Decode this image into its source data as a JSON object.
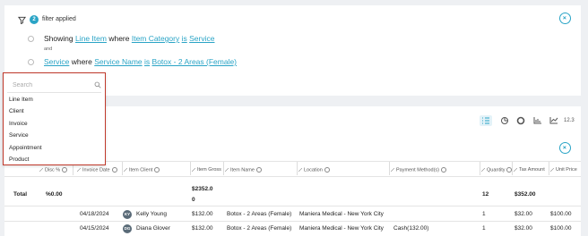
{
  "filter": {
    "count": "2",
    "label": "filter applied",
    "conditions": [
      {
        "prefix": "Showing",
        "field": "Line Item",
        "where": "where",
        "attribute": "Item Category",
        "operator": "is",
        "value": "Service"
      },
      {
        "prefix": "",
        "field": "Service",
        "where": "where",
        "attribute": "Service Name",
        "operator": "is",
        "value": "Botox - 2 Areas (Female)"
      }
    ],
    "and_label": "and"
  },
  "dropdown": {
    "search_placeholder": "Search",
    "items": [
      "Line Item",
      "Client",
      "Invoice",
      "Service",
      "Appointment",
      "Product"
    ]
  },
  "toolbar": {
    "number_format_label": "12.3"
  },
  "table": {
    "headers": [
      "Disc %",
      "Invoice Date",
      "Item Client",
      "Item Gross",
      "Item Name",
      "Location",
      "Payment Method(s)",
      "Quantity",
      "Tax Amount",
      "Unit Price"
    ],
    "total": {
      "label": "Total",
      "disc": "%0.00",
      "gross_line1": "$2352.0",
      "gross_line2": "0",
      "quantity": "12",
      "tax": "$352.00"
    },
    "rows": [
      {
        "date": "04/18/2024",
        "initials": "KY",
        "client": "Kelly Young",
        "gross": "$132.00",
        "item": "Botox - 2 Areas (Female)",
        "location": "Maniera Medical - New York City",
        "payment": "",
        "quantity": "1",
        "tax": "$32.00",
        "unit": "$100.00"
      },
      {
        "date": "04/15/2024",
        "initials": "DG",
        "client": "Diana Glover",
        "gross": "$132.00",
        "item": "Botox - 2 Areas (Female)",
        "location": "Maniera Medical - New York City",
        "payment": "Cash(132.00)",
        "quantity": "1",
        "tax": "$32.00",
        "unit": "$100.00"
      }
    ]
  },
  "colors": {
    "accent": "#2aa4c6",
    "highlight_border": "#c0392b"
  },
  "icons": [
    "funnel-icon",
    "close-icon",
    "search-icon",
    "list-view-icon",
    "pie-chart-icon",
    "donut-chart-icon",
    "bar-chart-icon",
    "line-chart-icon",
    "info-icon",
    "sort-icon"
  ]
}
